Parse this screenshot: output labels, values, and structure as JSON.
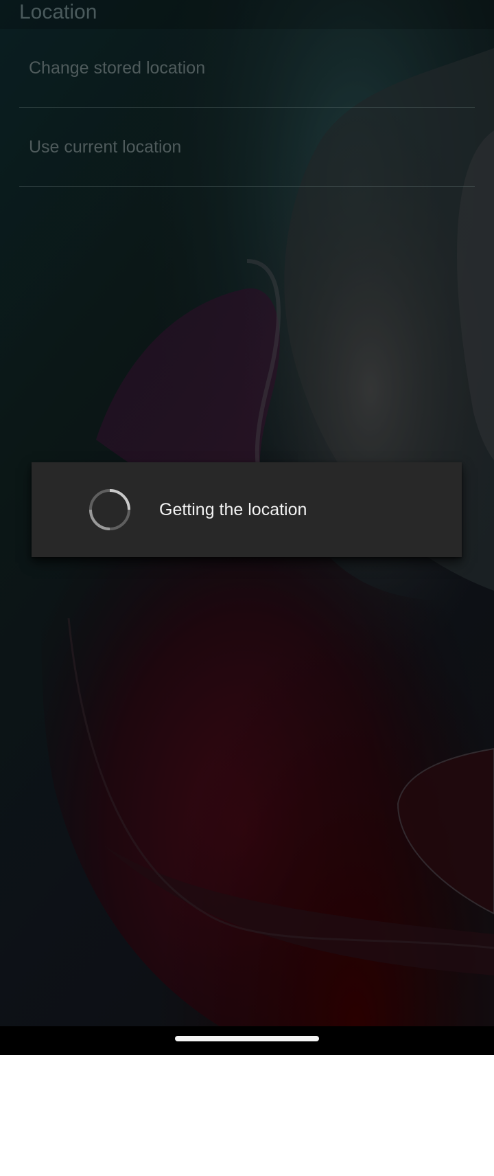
{
  "header": {
    "title": "Location"
  },
  "list": {
    "items": [
      {
        "label": "Change stored location"
      },
      {
        "label": "Use current location"
      }
    ]
  },
  "dialog": {
    "message": "Getting the location",
    "spinner_icon": "progress-spinner-icon"
  },
  "nav": {
    "handle_icon": "home-gesture-handle"
  },
  "colors": {
    "dialog_background": "#282828",
    "dialog_text": "#f2f2f2",
    "dimmed_text": "#4f5b5c",
    "nav_bar": "#000000"
  }
}
